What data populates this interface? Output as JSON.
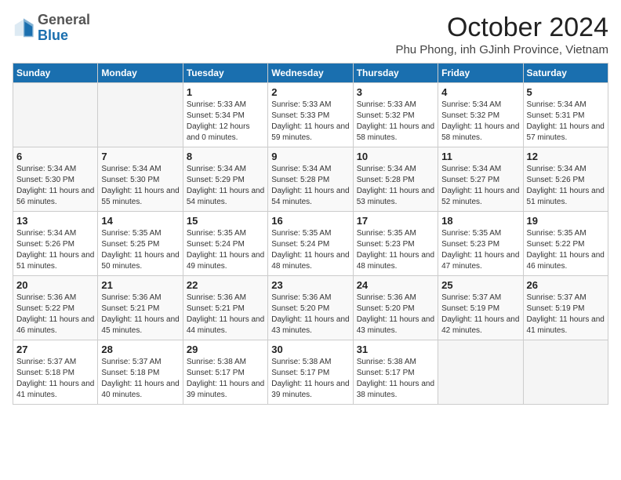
{
  "logo": {
    "general": "General",
    "blue": "Blue"
  },
  "header": {
    "month_title": "October 2024",
    "subtitle": "Phu Phong, inh GJinh Province, Vietnam"
  },
  "days_of_week": [
    "Sunday",
    "Monday",
    "Tuesday",
    "Wednesday",
    "Thursday",
    "Friday",
    "Saturday"
  ],
  "weeks": [
    [
      {
        "day": null
      },
      {
        "day": null
      },
      {
        "day": "1",
        "sunrise": "Sunrise: 5:33 AM",
        "sunset": "Sunset: 5:34 PM",
        "daylight": "Daylight: 12 hours and 0 minutes."
      },
      {
        "day": "2",
        "sunrise": "Sunrise: 5:33 AM",
        "sunset": "Sunset: 5:33 PM",
        "daylight": "Daylight: 11 hours and 59 minutes."
      },
      {
        "day": "3",
        "sunrise": "Sunrise: 5:33 AM",
        "sunset": "Sunset: 5:32 PM",
        "daylight": "Daylight: 11 hours and 58 minutes."
      },
      {
        "day": "4",
        "sunrise": "Sunrise: 5:34 AM",
        "sunset": "Sunset: 5:32 PM",
        "daylight": "Daylight: 11 hours and 58 minutes."
      },
      {
        "day": "5",
        "sunrise": "Sunrise: 5:34 AM",
        "sunset": "Sunset: 5:31 PM",
        "daylight": "Daylight: 11 hours and 57 minutes."
      }
    ],
    [
      {
        "day": "6",
        "sunrise": "Sunrise: 5:34 AM",
        "sunset": "Sunset: 5:30 PM",
        "daylight": "Daylight: 11 hours and 56 minutes."
      },
      {
        "day": "7",
        "sunrise": "Sunrise: 5:34 AM",
        "sunset": "Sunset: 5:30 PM",
        "daylight": "Daylight: 11 hours and 55 minutes."
      },
      {
        "day": "8",
        "sunrise": "Sunrise: 5:34 AM",
        "sunset": "Sunset: 5:29 PM",
        "daylight": "Daylight: 11 hours and 54 minutes."
      },
      {
        "day": "9",
        "sunrise": "Sunrise: 5:34 AM",
        "sunset": "Sunset: 5:28 PM",
        "daylight": "Daylight: 11 hours and 54 minutes."
      },
      {
        "day": "10",
        "sunrise": "Sunrise: 5:34 AM",
        "sunset": "Sunset: 5:28 PM",
        "daylight": "Daylight: 11 hours and 53 minutes."
      },
      {
        "day": "11",
        "sunrise": "Sunrise: 5:34 AM",
        "sunset": "Sunset: 5:27 PM",
        "daylight": "Daylight: 11 hours and 52 minutes."
      },
      {
        "day": "12",
        "sunrise": "Sunrise: 5:34 AM",
        "sunset": "Sunset: 5:26 PM",
        "daylight": "Daylight: 11 hours and 51 minutes."
      }
    ],
    [
      {
        "day": "13",
        "sunrise": "Sunrise: 5:34 AM",
        "sunset": "Sunset: 5:26 PM",
        "daylight": "Daylight: 11 hours and 51 minutes."
      },
      {
        "day": "14",
        "sunrise": "Sunrise: 5:35 AM",
        "sunset": "Sunset: 5:25 PM",
        "daylight": "Daylight: 11 hours and 50 minutes."
      },
      {
        "day": "15",
        "sunrise": "Sunrise: 5:35 AM",
        "sunset": "Sunset: 5:24 PM",
        "daylight": "Daylight: 11 hours and 49 minutes."
      },
      {
        "day": "16",
        "sunrise": "Sunrise: 5:35 AM",
        "sunset": "Sunset: 5:24 PM",
        "daylight": "Daylight: 11 hours and 48 minutes."
      },
      {
        "day": "17",
        "sunrise": "Sunrise: 5:35 AM",
        "sunset": "Sunset: 5:23 PM",
        "daylight": "Daylight: 11 hours and 48 minutes."
      },
      {
        "day": "18",
        "sunrise": "Sunrise: 5:35 AM",
        "sunset": "Sunset: 5:23 PM",
        "daylight": "Daylight: 11 hours and 47 minutes."
      },
      {
        "day": "19",
        "sunrise": "Sunrise: 5:35 AM",
        "sunset": "Sunset: 5:22 PM",
        "daylight": "Daylight: 11 hours and 46 minutes."
      }
    ],
    [
      {
        "day": "20",
        "sunrise": "Sunrise: 5:36 AM",
        "sunset": "Sunset: 5:22 PM",
        "daylight": "Daylight: 11 hours and 46 minutes."
      },
      {
        "day": "21",
        "sunrise": "Sunrise: 5:36 AM",
        "sunset": "Sunset: 5:21 PM",
        "daylight": "Daylight: 11 hours and 45 minutes."
      },
      {
        "day": "22",
        "sunrise": "Sunrise: 5:36 AM",
        "sunset": "Sunset: 5:21 PM",
        "daylight": "Daylight: 11 hours and 44 minutes."
      },
      {
        "day": "23",
        "sunrise": "Sunrise: 5:36 AM",
        "sunset": "Sunset: 5:20 PM",
        "daylight": "Daylight: 11 hours and 43 minutes."
      },
      {
        "day": "24",
        "sunrise": "Sunrise: 5:36 AM",
        "sunset": "Sunset: 5:20 PM",
        "daylight": "Daylight: 11 hours and 43 minutes."
      },
      {
        "day": "25",
        "sunrise": "Sunrise: 5:37 AM",
        "sunset": "Sunset: 5:19 PM",
        "daylight": "Daylight: 11 hours and 42 minutes."
      },
      {
        "day": "26",
        "sunrise": "Sunrise: 5:37 AM",
        "sunset": "Sunset: 5:19 PM",
        "daylight": "Daylight: 11 hours and 41 minutes."
      }
    ],
    [
      {
        "day": "27",
        "sunrise": "Sunrise: 5:37 AM",
        "sunset": "Sunset: 5:18 PM",
        "daylight": "Daylight: 11 hours and 41 minutes."
      },
      {
        "day": "28",
        "sunrise": "Sunrise: 5:37 AM",
        "sunset": "Sunset: 5:18 PM",
        "daylight": "Daylight: 11 hours and 40 minutes."
      },
      {
        "day": "29",
        "sunrise": "Sunrise: 5:38 AM",
        "sunset": "Sunset: 5:17 PM",
        "daylight": "Daylight: 11 hours and 39 minutes."
      },
      {
        "day": "30",
        "sunrise": "Sunrise: 5:38 AM",
        "sunset": "Sunset: 5:17 PM",
        "daylight": "Daylight: 11 hours and 39 minutes."
      },
      {
        "day": "31",
        "sunrise": "Sunrise: 5:38 AM",
        "sunset": "Sunset: 5:17 PM",
        "daylight": "Daylight: 11 hours and 38 minutes."
      },
      {
        "day": null
      },
      {
        "day": null
      }
    ]
  ]
}
